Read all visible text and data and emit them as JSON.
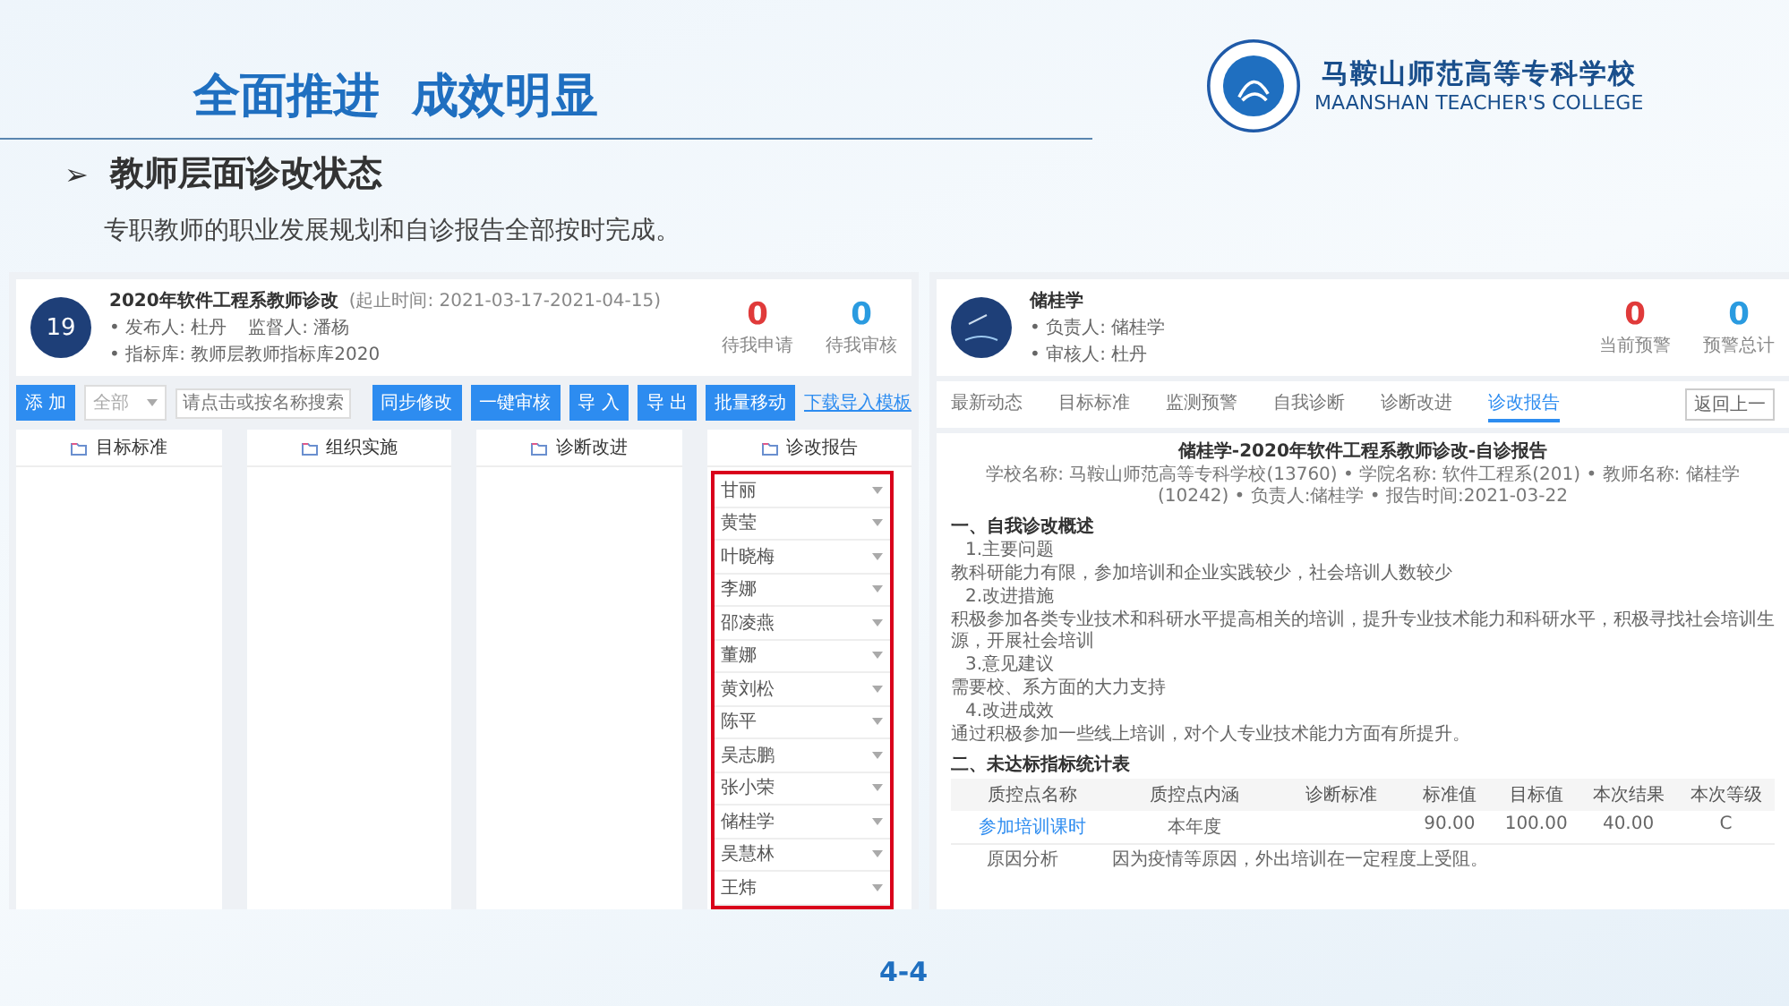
{
  "slide": {
    "title": "全面推进  成效明显",
    "bullet": "➢",
    "subtitle": "教师层面诊改状态",
    "description": "专职教师的职业发展规划和自诊报告全部按时完成。",
    "page_number": "4-4"
  },
  "logo": {
    "name_cn": "马鞍山师范高等专科学校",
    "name_en": "MAANSHAN TEACHER'S COLLEGE"
  },
  "left_screen": {
    "avatar": "19",
    "title": "2020年软件工程系教师诊改",
    "period": "(起止时间: 2021-03-17-2021-04-15)",
    "meta": [
      [
        "• 发布人: 杜丹",
        "监督人: 潘杨"
      ],
      [
        "• 指标库: 教师层教师指标库2020"
      ]
    ],
    "stats": [
      {
        "value": "0",
        "label": "待我申请",
        "color": "#e03a3a"
      },
      {
        "value": "0",
        "label": "待我审核",
        "color": "#2a9be0"
      }
    ],
    "add_button": "添 加",
    "select": "全部",
    "search": {
      "placeholder": "请点击或按名称搜索"
    },
    "buttons": [
      "同步修改",
      "一键审核",
      "导 入",
      "导 出",
      "批量移动"
    ],
    "link": "下载导入模板",
    "columns": [
      {
        "title": "目标标准"
      },
      {
        "title": "组织实施"
      },
      {
        "title": "诊断改进"
      },
      {
        "title": "诊改报告",
        "highlighted": true,
        "items": [
          "甘丽",
          "黄莹",
          "叶晓梅",
          "李娜",
          "邵凌燕",
          "董娜",
          "黄刘松",
          "陈平",
          "吴志鹏",
          "张小荣",
          "储桂学",
          "吴慧林",
          "王炜"
        ]
      }
    ]
  },
  "right_screen": {
    "name": "储桂学",
    "meta": [
      "• 负责人: 储桂学",
      "• 审核人: 杜丹"
    ],
    "stats": [
      {
        "value": "0",
        "label": "当前预警",
        "color": "#e03a3a"
      },
      {
        "value": "0",
        "label": "预警总计",
        "color": "#2a9be0"
      }
    ],
    "tabs": [
      {
        "label": "最新动态",
        "selected": false
      },
      {
        "label": "目标标准",
        "selected": false
      },
      {
        "label": "监测预警",
        "selected": false
      },
      {
        "label": "自我诊断",
        "selected": false
      },
      {
        "label": "诊断改进",
        "selected": false
      },
      {
        "label": "诊改报告",
        "selected": true
      }
    ],
    "back_button": "返回上一",
    "report_title": "储桂学-2020年软件工程系教师诊改-自诊报告",
    "report_meta": "学校名称: 马鞍山师范高等专科学校(13760) • 学院名称: 软件工程系(201) • 教师名称: 储桂学(10242) • 负责人:储桂学 • 报告时间:2021-03-22",
    "section_1": {
      "heading": "一、自我诊改概述",
      "items": [
        {
          "label": "1.主要问题",
          "text": "教科研能力有限，参加培训和企业实践较少，社会培训人数较少"
        },
        {
          "label": "2.改进措施",
          "text": "积极参加各类专业技术和科研水平提高相关的培训，提升专业技术能力和科研水平，积极寻找社会培训生源，开展社会培训"
        },
        {
          "label": "3.意见建议",
          "text": "需要校、系方面的大力支持"
        },
        {
          "label": "4.改进成效",
          "text": "通过积极参加一些线上培训，对个人专业技术能力方面有所提升。"
        }
      ]
    },
    "section_2": {
      "heading": "二、未达标指标统计表",
      "columns": [
        "质控点名称",
        "质控点内涵",
        "诊断标准",
        "标准值",
        "目标值",
        "本次结果",
        "本次等级"
      ],
      "rows": [
        [
          "参加培训课时",
          "本年度",
          "",
          "90.00",
          "100.00",
          "40.00",
          "C"
        ]
      ],
      "analysis": {
        "label": "原因分析",
        "text": "因为疫情等原因，外出培训在一定程度上受阻。"
      }
    }
  }
}
